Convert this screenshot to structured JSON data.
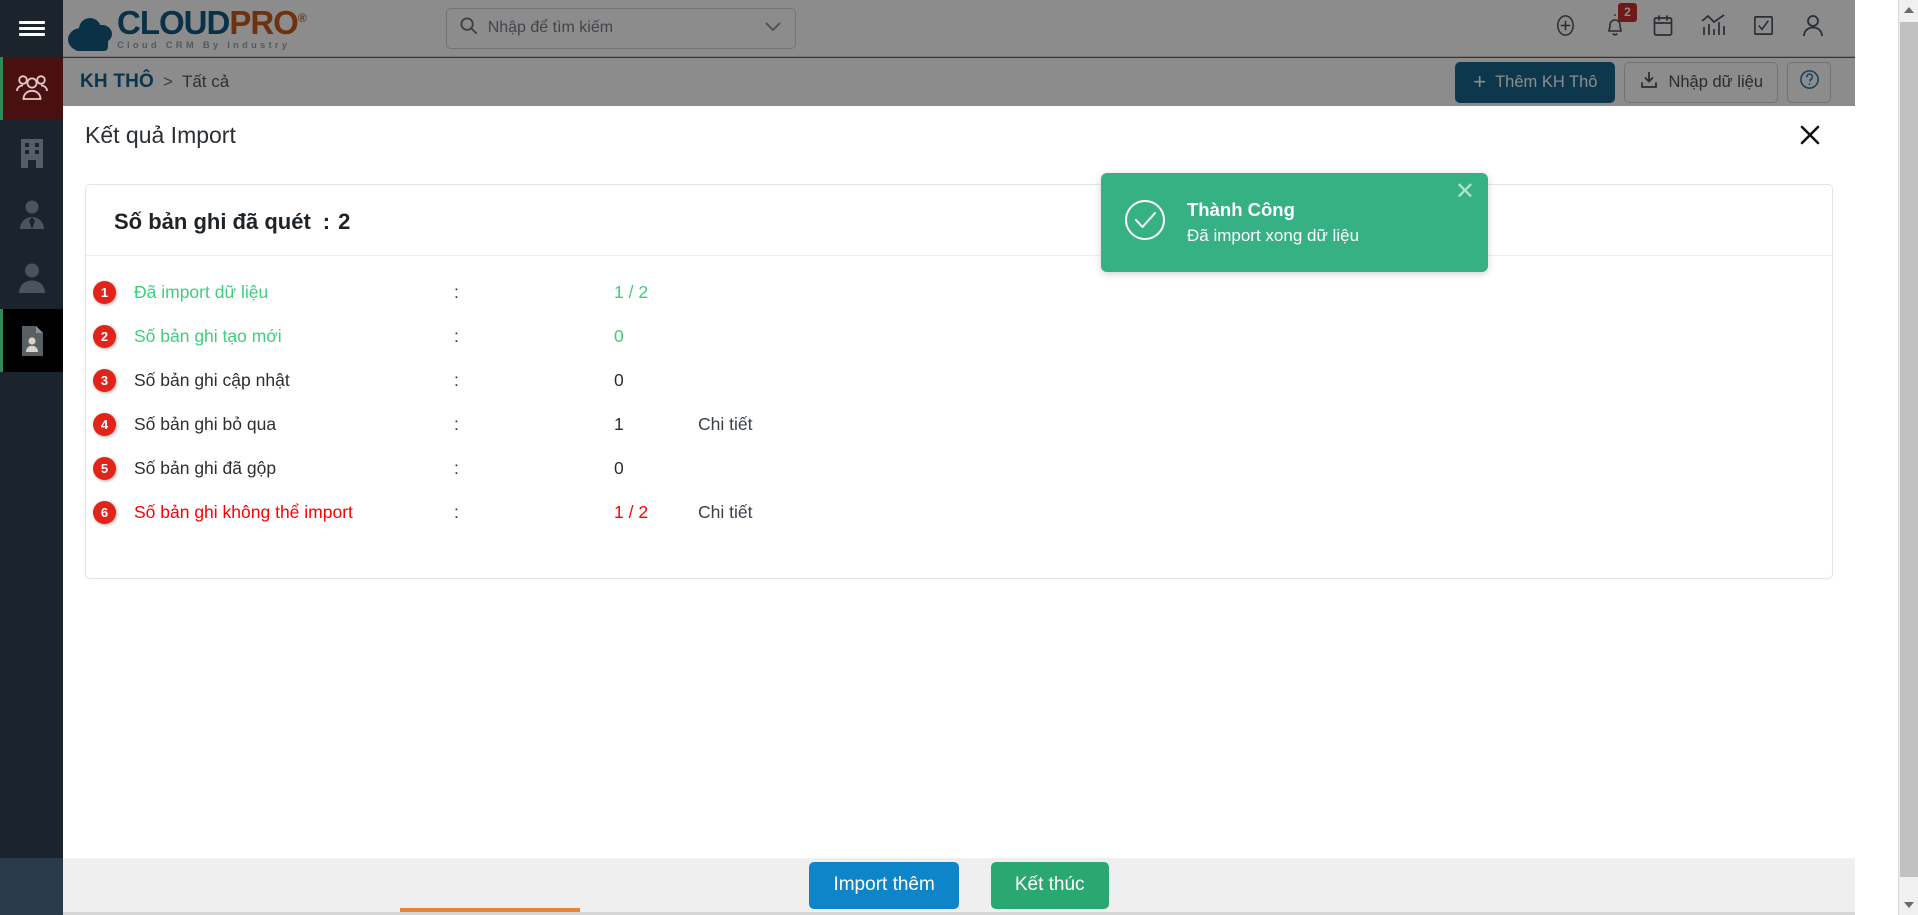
{
  "brand": {
    "logo_main_1": "CLOUD",
    "logo_main_2": "PRO",
    "logo_reg": "®",
    "logo_sub": "Cloud CRM By Industry"
  },
  "search": {
    "placeholder": "Nhập để tìm kiếm",
    "value": ""
  },
  "header_icons": [
    {
      "name": "add-circle-icon"
    },
    {
      "name": "bell-icon",
      "badge": "2"
    },
    {
      "name": "calendar-icon"
    },
    {
      "name": "analytics-icon"
    },
    {
      "name": "checkbox-task-icon"
    },
    {
      "name": "user-account-icon"
    }
  ],
  "breadcrumb": {
    "main": "KH THÔ",
    "separator": ">",
    "sub": "Tất cả"
  },
  "crumb_actions": {
    "add_label": "Thêm KH Thô",
    "add_plus": "+",
    "import_label": "Nhập dữ liệu",
    "help_label": "?"
  },
  "sidebar": {
    "items": [
      {
        "name": "sidebar-item-contacts-group",
        "icon": "people-group-icon",
        "state": "active-red"
      },
      {
        "name": "sidebar-item-company",
        "icon": "building-icon",
        "state": ""
      },
      {
        "name": "sidebar-item-employee",
        "icon": "person-tie-icon",
        "state": ""
      },
      {
        "name": "sidebar-item-customer",
        "icon": "person-icon",
        "state": ""
      },
      {
        "name": "sidebar-item-raw-lead",
        "icon": "document-person-icon",
        "state": "active-black"
      }
    ]
  },
  "modal": {
    "title": "Kết quả Import",
    "close_label": "✕",
    "scan": {
      "label": "Số bản ghi đã quét",
      "colon": ":",
      "value": "2"
    },
    "rows": [
      {
        "num": "1",
        "label": "Đã import dữ liệu",
        "colon": ":",
        "value": "1 / 2",
        "detail": "",
        "color": "green"
      },
      {
        "num": "2",
        "label": "Số bản ghi tạo mới",
        "colon": ":",
        "value": "0",
        "detail": "",
        "color": "green"
      },
      {
        "num": "3",
        "label": "Số bản ghi cập nhật",
        "colon": ":",
        "value": "0",
        "detail": "",
        "color": "default"
      },
      {
        "num": "4",
        "label": "Số bản ghi bỏ qua",
        "colon": ":",
        "value": "1",
        "detail": "Chi tiết",
        "color": "default"
      },
      {
        "num": "5",
        "label": "Số bản ghi đã gộp",
        "colon": ":",
        "value": "0",
        "detail": "",
        "color": "default"
      },
      {
        "num": "6",
        "label": "Số bản ghi không thể import",
        "colon": ":",
        "value": "1 / 2",
        "detail": "Chi tiết",
        "color": "red"
      }
    ]
  },
  "toast": {
    "title": "Thành Công",
    "message": "Đã import xong dữ liệu",
    "close_label": "✕",
    "icon": "check-circle-icon",
    "color": "#35b185"
  },
  "footer": {
    "import_more_label": "Import thêm",
    "finish_label": "Kết thúc"
  },
  "colors": {
    "accent_blue": "#0d85c8",
    "accent_green": "#2aa871",
    "danger_red": "#e2231a",
    "sidebar_bg": "#1b242d",
    "brand_dark_blue": "#155a80",
    "brand_orange": "#cc5a1c"
  }
}
